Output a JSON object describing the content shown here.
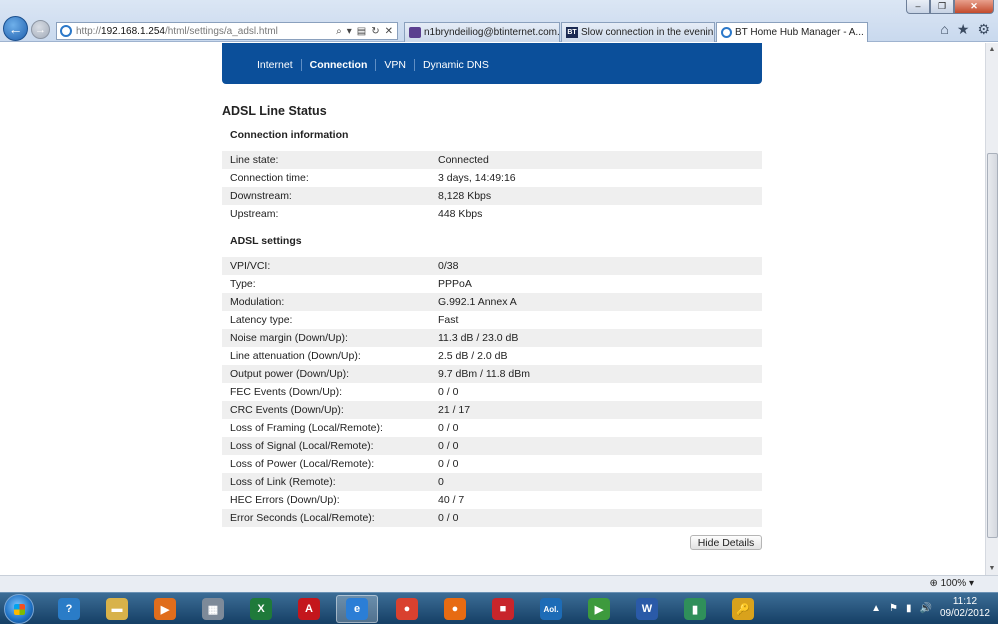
{
  "browser": {
    "window_controls": {
      "minimize": "–",
      "restore": "❐",
      "close": "✕"
    },
    "back_glyph": "←",
    "forward_glyph": "→",
    "address": {
      "prefix": "http://",
      "host": "192.168.1.254",
      "path": "/html/settings/a_adsl.html"
    },
    "address_icons": {
      "search": "⌕",
      "dropdown": "▾",
      "compat": "▤",
      "refresh": "↻",
      "stop": "✕"
    },
    "tabs": [
      {
        "label": "n1bryndeiliog@btinternet.com...",
        "favicon": "mail-icon"
      },
      {
        "label": "Slow connection in the evenin...",
        "favicon": "bt-icon",
        "favicon_text": "BT"
      },
      {
        "label": "BT Home Hub Manager - A...",
        "favicon": "ie-icon"
      }
    ],
    "tab_close": "✕",
    "toolbar_icons": {
      "home": "⌂",
      "favorites": "★",
      "tools": "⚙"
    }
  },
  "subnav": {
    "items": [
      "Internet",
      "Connection",
      "VPN",
      "Dynamic DNS"
    ],
    "active": "Connection"
  },
  "page": {
    "title": "ADSL Line Status",
    "connection_section_title": "Connection information",
    "connection_rows": [
      {
        "label": "Line state:",
        "value": "Connected"
      },
      {
        "label": "Connection time:",
        "value": "3 days, 14:49:16"
      },
      {
        "label": "Downstream:",
        "value": "8,128 Kbps"
      },
      {
        "label": "Upstream:",
        "value": "448 Kbps"
      }
    ],
    "adsl_section_title": "ADSL settings",
    "adsl_rows": [
      {
        "label": "VPI/VCI:",
        "value": "0/38"
      },
      {
        "label": "Type:",
        "value": "PPPoA"
      },
      {
        "label": "Modulation:",
        "value": "G.992.1 Annex A"
      },
      {
        "label": "Latency type:",
        "value": "Fast"
      },
      {
        "label": "Noise margin (Down/Up):",
        "value": "11.3 dB / 23.0 dB"
      },
      {
        "label": "Line attenuation (Down/Up):",
        "value": "2.5 dB / 2.0 dB"
      },
      {
        "label": "Output power (Down/Up):",
        "value": "9.7 dBm / 11.8 dBm"
      },
      {
        "label": "FEC Events (Down/Up):",
        "value": "0 / 0"
      },
      {
        "label": "CRC Events (Down/Up):",
        "value": "21 / 17"
      },
      {
        "label": "Loss of Framing (Local/Remote):",
        "value": "0 / 0"
      },
      {
        "label": "Loss of Signal (Local/Remote):",
        "value": "0 / 0"
      },
      {
        "label": "Loss of Power (Local/Remote):",
        "value": "0 / 0"
      },
      {
        "label": "Loss of Link (Remote):",
        "value": "0"
      },
      {
        "label": "HEC Errors (Down/Up):",
        "value": "40 / 7"
      },
      {
        "label": "Error Seconds (Local/Remote):",
        "value": "0 / 0"
      }
    ],
    "hide_details_label": "Hide Details"
  },
  "statusbar": {
    "zoom": "100%"
  },
  "taskbar": {
    "apps": [
      {
        "name": "help-icon",
        "glyph": "?",
        "color": "#2a7cc7"
      },
      {
        "name": "explorer-folder-icon",
        "glyph": "▬",
        "color": "#d8b24a"
      },
      {
        "name": "media-player-icon",
        "glyph": "▶",
        "color": "#e06d1c"
      },
      {
        "name": "calculator-icon",
        "glyph": "▦",
        "color": "#7d8a99"
      },
      {
        "name": "excel-icon",
        "glyph": "X",
        "color": "#1f7a3a"
      },
      {
        "name": "acrobat-icon",
        "glyph": "A",
        "color": "#c4161c"
      },
      {
        "name": "internet-explorer-icon",
        "glyph": "e",
        "color": "#2b7ed6"
      },
      {
        "name": "chrome-icon",
        "glyph": "●",
        "color": "#d9412f"
      },
      {
        "name": "firefox-icon",
        "glyph": "●",
        "color": "#e76b12"
      },
      {
        "name": "flag-app-icon",
        "glyph": "■",
        "color": "#c8252b"
      },
      {
        "name": "aol-icon",
        "glyph": "Aol.",
        "color": "#1d6cb7"
      },
      {
        "name": "video-app-icon",
        "glyph": "▶",
        "color": "#3d9a3d"
      },
      {
        "name": "word-icon",
        "glyph": "W",
        "color": "#2a5aa8"
      },
      {
        "name": "book-icon",
        "glyph": "▮",
        "color": "#2f8f5a"
      },
      {
        "name": "key-app-icon",
        "glyph": "🔑",
        "color": "#d9a21c"
      }
    ],
    "tray_icons": {
      "arrow": "▲",
      "flag": "⚑",
      "network": "▮",
      "volume": "🔊"
    },
    "time": "11:12",
    "date": "09/02/2012"
  }
}
